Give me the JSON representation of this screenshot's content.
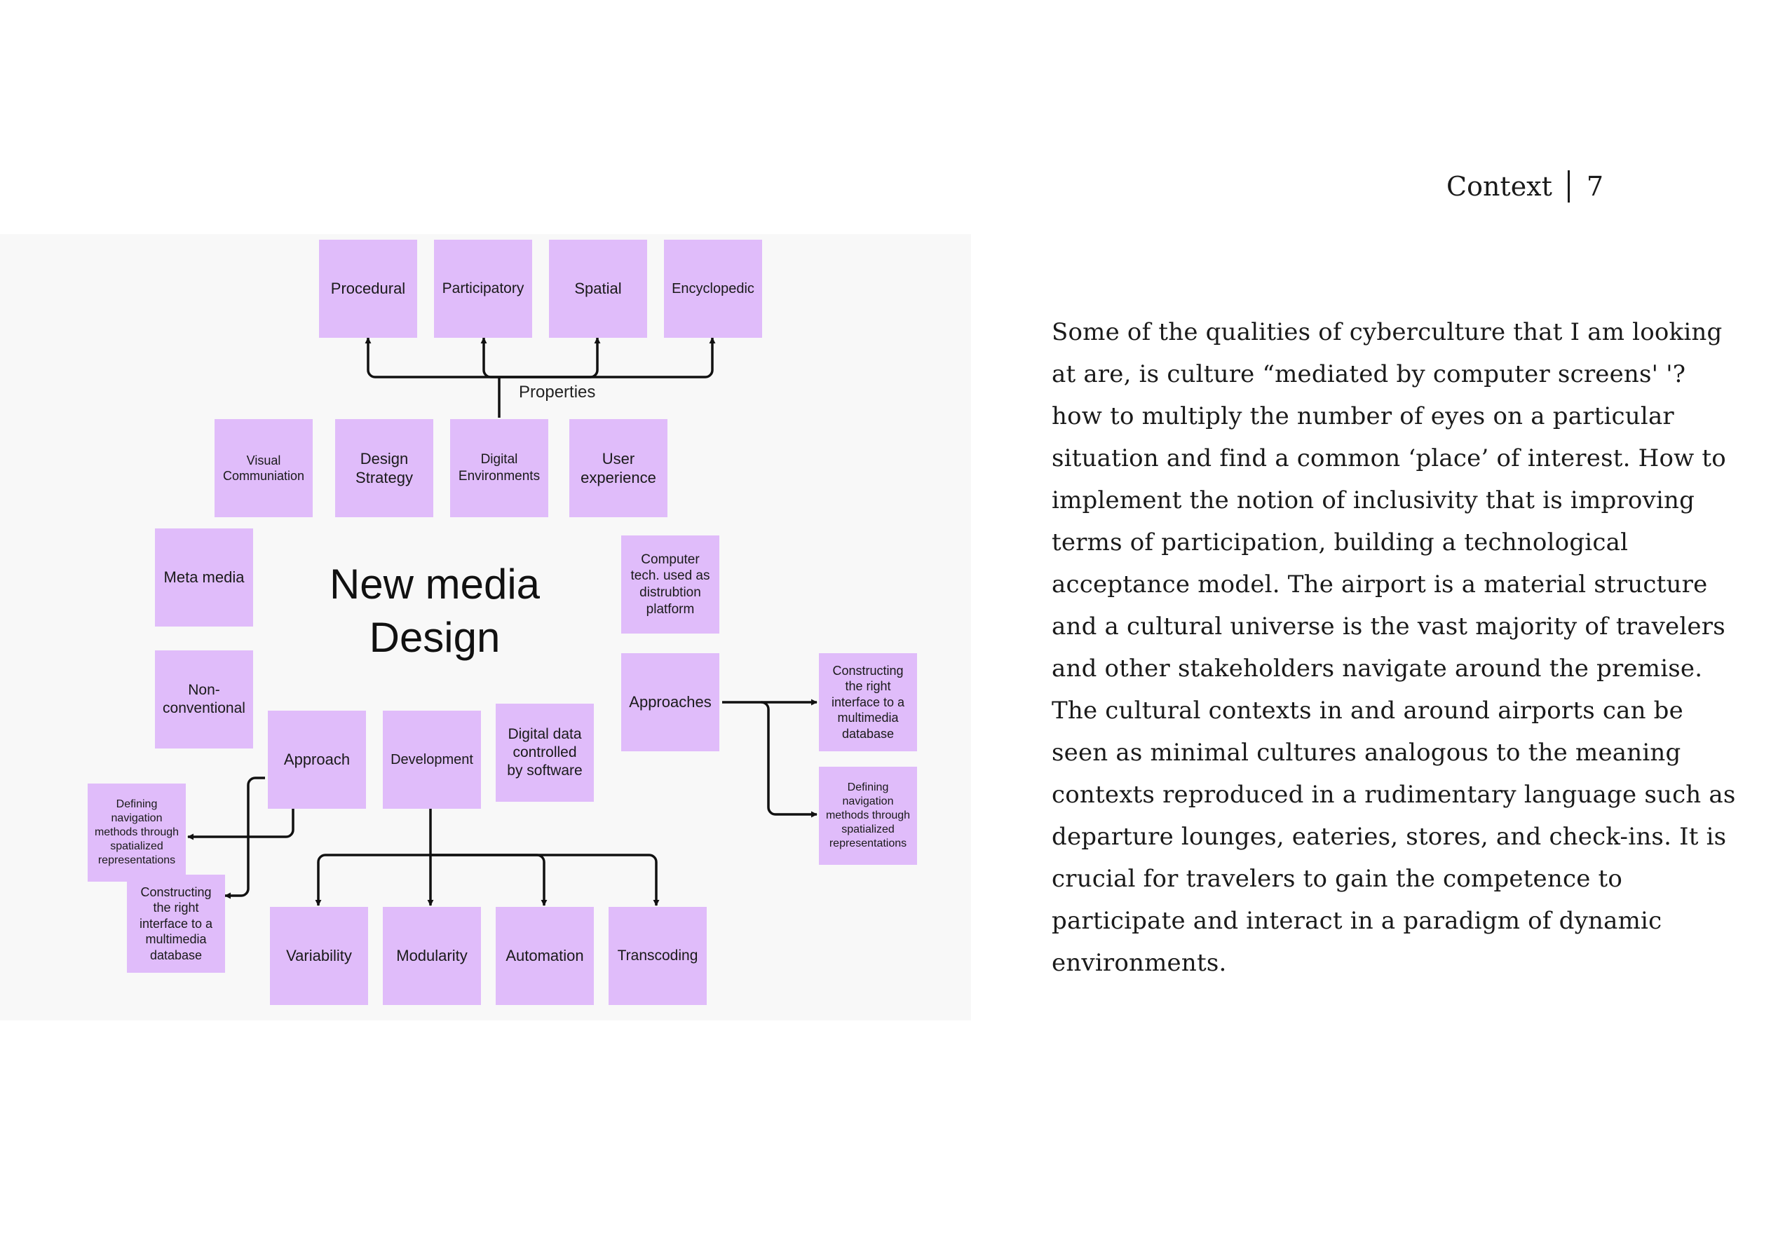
{
  "header": {
    "section": "Context",
    "page_number": "7"
  },
  "diagram": {
    "title": "New media\nDesign",
    "properties_label": "Properties",
    "note_color": "#e0bcfa",
    "line_color": "#111111",
    "notes": {
      "procedural": "Procedural",
      "participatory": "Participatory",
      "spatial": "Spatial",
      "encyclopedic": "Encyclopedic",
      "visual_communiation": "Visual\nCommuniation",
      "design_strategy": "Design\nStrategy",
      "digital_environments": "Digital\nEnvironments",
      "user_experience": "User\nexperience",
      "meta_media": "Meta media",
      "computer_tech": "Computer\ntech. used as\ndistrubtion\nplatform",
      "non_conventional": "Non-\nconventional",
      "approaches": "Approaches",
      "constructing_right": "Constructing\nthe right\ninterface to a\nmultimedia\ndatabase",
      "defining_right": "Defining\nnavigation\nmethods through\nspatialized\nrepresentations",
      "approach": "Approach",
      "development": "Development",
      "digital_data": "Digital data\ncontrolled\nby software",
      "defining_left": "Defining\nnavigation\nmethods through\nspatialized\nrepresentations",
      "constructing_left": "Constructing\nthe right\ninterface to a\nmultimedia\ndatabase",
      "variability": "Variability",
      "modularity": "Modularity",
      "automation": "Automation",
      "transcoding": "Transcoding"
    }
  },
  "body_text": "Some of the qualities of cyberculture that I am looking at are, is culture “mediated by computer screens' '? how to multiply the number of eyes on a particular situation and find a common ‘place’ of interest. How to implement the notion of inclusivity that is improving terms of participation, building a technological acceptance model. The airport is a material structure and a cultural universe is the vast majority of travelers and other stakeholders navigate around the premise. The cultural contexts in and around airports can be seen as minimal cultures analogous to the meaning contexts reproduced in a rudimentary language such as departure lounges, eateries, stores, and check-ins. It is crucial for travelers to gain the competence to participate and interact in a paradigm of dynamic environments."
}
